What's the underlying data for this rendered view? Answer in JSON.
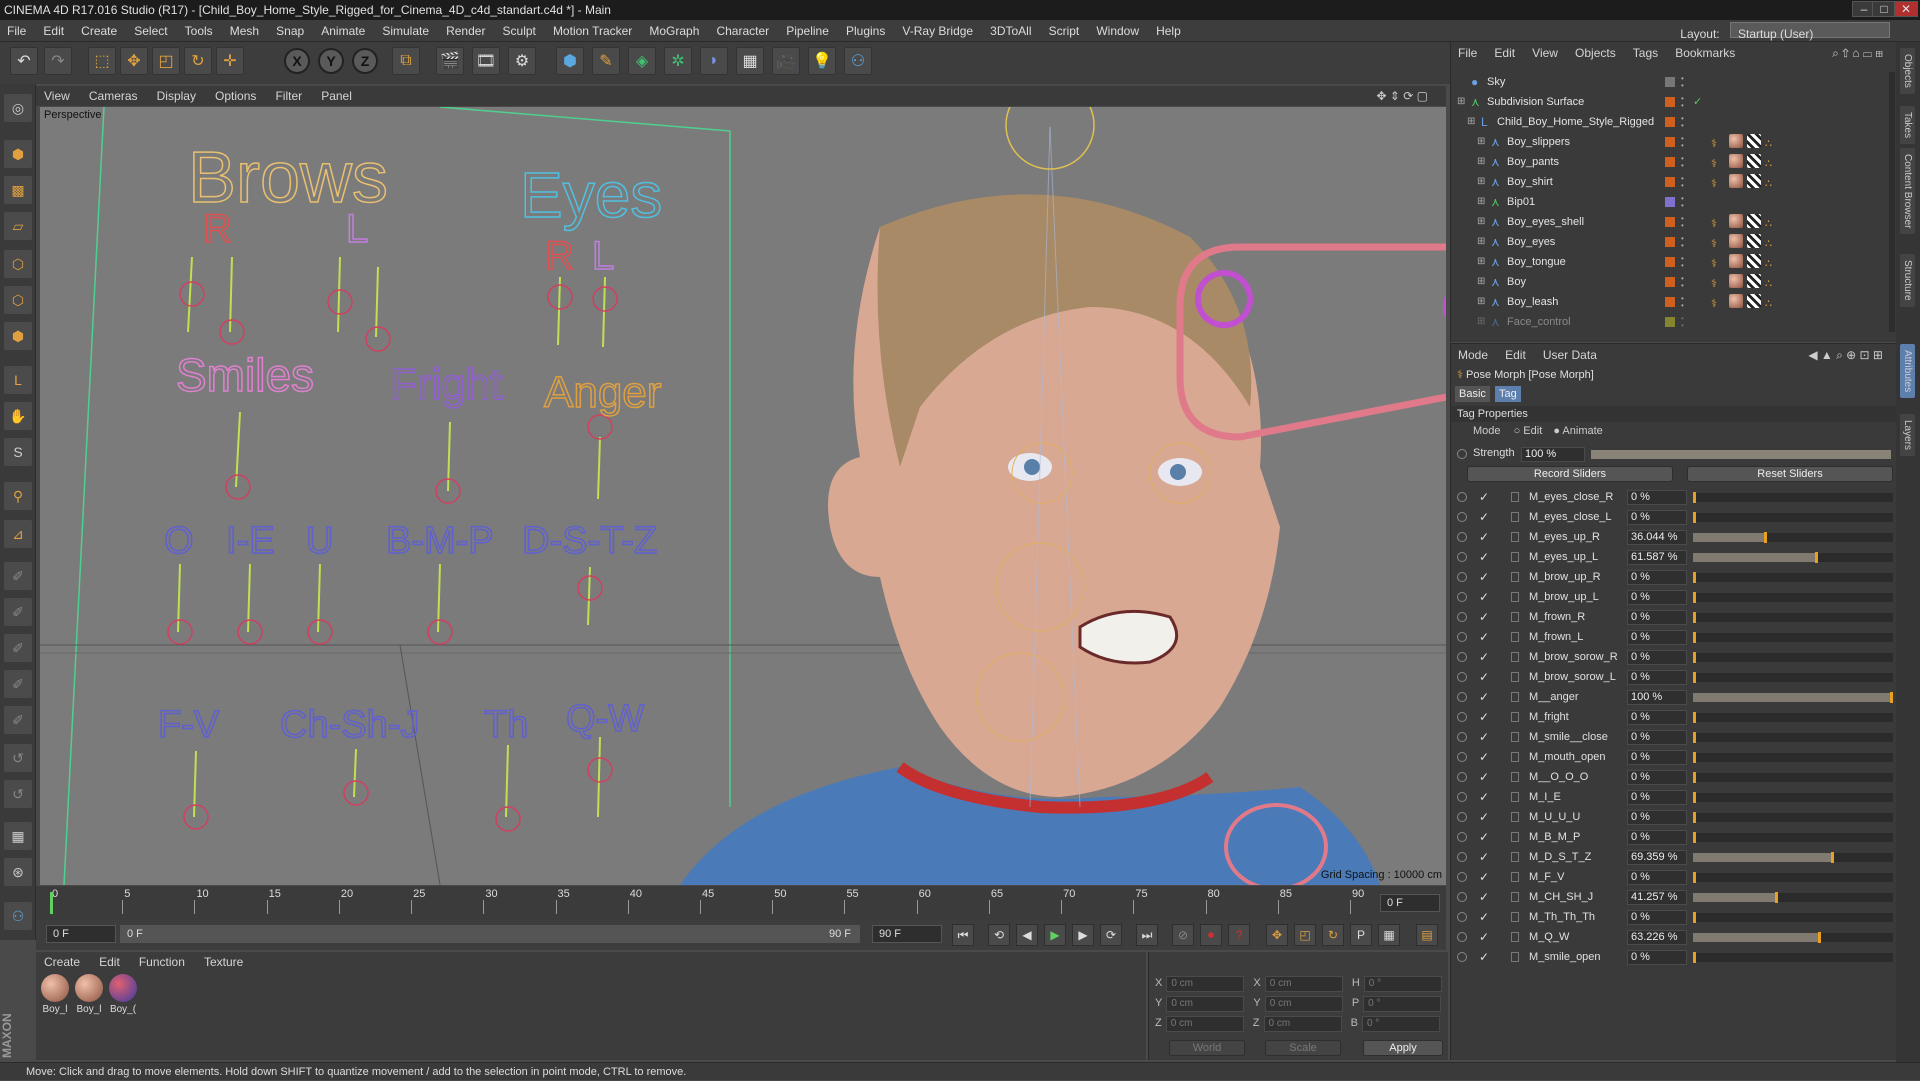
{
  "window": {
    "title": "CINEMA 4D R17.016 Studio (R17) - [Child_Boy_Home_Style_Rigged_for_Cinema_4D_c4d_standart.c4d *] - Main"
  },
  "menubar": [
    "File",
    "Edit",
    "Create",
    "Select",
    "Tools",
    "Mesh",
    "Snap",
    "Animate",
    "Simulate",
    "Render",
    "Sculpt",
    "Motion Tracker",
    "MoGraph",
    "Character",
    "Pipeline",
    "Plugins",
    "V-Ray Bridge",
    "3DToAll",
    "Script",
    "Window",
    "Help"
  ],
  "layout": {
    "label": "Layout:",
    "value": "Startup (User)"
  },
  "toolbar": {
    "x": "X",
    "y": "Y",
    "z": "Z"
  },
  "viewport": {
    "menu": [
      "View",
      "Cameras",
      "Display",
      "Options",
      "Filter",
      "Panel"
    ],
    "name": "Perspective",
    "grid_spacing": "Grid Spacing : 10000 cm",
    "face_controls": {
      "brows": "Brows",
      "brows_r": "R",
      "brows_l": "L",
      "eyes": "Eyes",
      "eyes_r": "R",
      "eyes_l": "L",
      "smiles": "Smiles",
      "fright": "Fright",
      "anger": "Anger",
      "o": "O",
      "ie": "I-E",
      "u": "U",
      "bmp": "B-M-P",
      "dstz": "D-S-T-Z",
      "fv": "F-V",
      "chshj": "Ch-Sh-J",
      "th": "Th",
      "qw": "Q-W"
    }
  },
  "timeline": {
    "ticks": [
      "0",
      "5",
      "10",
      "15",
      "20",
      "25",
      "30",
      "35",
      "40",
      "45",
      "50",
      "55",
      "60",
      "65",
      "70",
      "75",
      "80",
      "85",
      "90"
    ],
    "current": "0 F"
  },
  "transport": {
    "start": "0 F",
    "range_start": "0 F",
    "range_end": "90 F",
    "end": "90 F"
  },
  "materials": {
    "menu": [
      "Create",
      "Edit",
      "Function",
      "Texture"
    ],
    "items": [
      "Boy_l",
      "Boy_l",
      "Boy_("
    ]
  },
  "coords": {
    "rows": [
      {
        "a": "X",
        "av": "0 cm",
        "b": "X",
        "bv": "0 cm",
        "c": "H",
        "cv": "0 °"
      },
      {
        "a": "Y",
        "av": "0 cm",
        "b": "Y",
        "bv": "0 cm",
        "c": "P",
        "cv": "0 °"
      },
      {
        "a": "Z",
        "av": "0 cm",
        "b": "Z",
        "bv": "0 cm",
        "c": "B",
        "cv": "0 °"
      }
    ],
    "mode1": "World",
    "mode2": "Scale",
    "apply": "Apply"
  },
  "status": "Move: Click and drag to move elements. Hold down SHIFT to quantize movement / add to the selection in point mode, CTRL to remove.",
  "objects": {
    "menu": [
      "File",
      "Edit",
      "View",
      "Objects",
      "Tags",
      "Bookmarks"
    ],
    "items": [
      {
        "name": "Sky",
        "indent": 0
      },
      {
        "name": "Subdivision Surface",
        "indent": 0
      },
      {
        "name": "Child_Boy_Home_Style_Rigged",
        "indent": 1
      },
      {
        "name": "Boy_slippers",
        "indent": 2
      },
      {
        "name": "Boy_pants",
        "indent": 2
      },
      {
        "name": "Boy_shirt",
        "indent": 2
      },
      {
        "name": "Bip01",
        "indent": 2
      },
      {
        "name": "Boy_eyes_shell",
        "indent": 2
      },
      {
        "name": "Boy_eyes",
        "indent": 2
      },
      {
        "name": "Boy_tongue",
        "indent": 2
      },
      {
        "name": "Boy",
        "indent": 2
      },
      {
        "name": "Boy_leash",
        "indent": 2
      },
      {
        "name": "Face_control",
        "indent": 2
      }
    ]
  },
  "attributes": {
    "menu": [
      "Mode",
      "Edit",
      "User Data"
    ],
    "object": "Pose Morph [Pose Morph]",
    "tabs": [
      "Basic",
      "Tag"
    ],
    "section": "Tag Properties",
    "mode_label": "Mode",
    "mode_edit": "Edit",
    "mode_animate": "Animate",
    "strength_label": "Strength",
    "strength_value": "100 %",
    "record": "Record Sliders",
    "reset": "Reset Sliders",
    "sliders": [
      {
        "name": "M_eyes_close_R",
        "value": "0 %",
        "pct": 0
      },
      {
        "name": "M_eyes_close_L",
        "value": "0 %",
        "pct": 0
      },
      {
        "name": "M_eyes_up_R",
        "value": "36.044 %",
        "pct": 36.044
      },
      {
        "name": "M_eyes_up_L",
        "value": "61.587 %",
        "pct": 61.587
      },
      {
        "name": "M_brow_up_R",
        "value": "0 %",
        "pct": 0
      },
      {
        "name": "M_brow_up_L",
        "value": "0 %",
        "pct": 0
      },
      {
        "name": "M_frown_R",
        "value": "0 %",
        "pct": 0
      },
      {
        "name": "M_frown_L",
        "value": "0 %",
        "pct": 0
      },
      {
        "name": "M_brow_sorow_R",
        "value": "0 %",
        "pct": 0
      },
      {
        "name": "M_brow_sorow_L",
        "value": "0 %",
        "pct": 0
      },
      {
        "name": "M__anger",
        "value": "100 %",
        "pct": 100
      },
      {
        "name": "M_fright",
        "value": "0 %",
        "pct": 0
      },
      {
        "name": "M_smile__close",
        "value": "0 %",
        "pct": 0
      },
      {
        "name": "M_mouth_open",
        "value": "0 %",
        "pct": 0
      },
      {
        "name": "M__O_O_O",
        "value": "0 %",
        "pct": 0
      },
      {
        "name": "M_I_E",
        "value": "0 %",
        "pct": 0
      },
      {
        "name": "M_U_U_U",
        "value": "0 %",
        "pct": 0
      },
      {
        "name": "M_B_M_P",
        "value": "0 %",
        "pct": 0
      },
      {
        "name": "M_D_S_T_Z",
        "value": "69.359 %",
        "pct": 69.359
      },
      {
        "name": "M_F_V",
        "value": "0 %",
        "pct": 0
      },
      {
        "name": "M_CH_SH_J",
        "value": "41.257 %",
        "pct": 41.257
      },
      {
        "name": "M_Th_Th_Th",
        "value": "0 %",
        "pct": 0
      },
      {
        "name": "M_Q_W",
        "value": "63.226 %",
        "pct": 63.226
      },
      {
        "name": "M_smile_open",
        "value": "0 %",
        "pct": 0
      }
    ]
  },
  "side_tabs": [
    "Objects",
    "Takes",
    "Content Browser",
    "Structure",
    "Attributes",
    "Layers"
  ]
}
